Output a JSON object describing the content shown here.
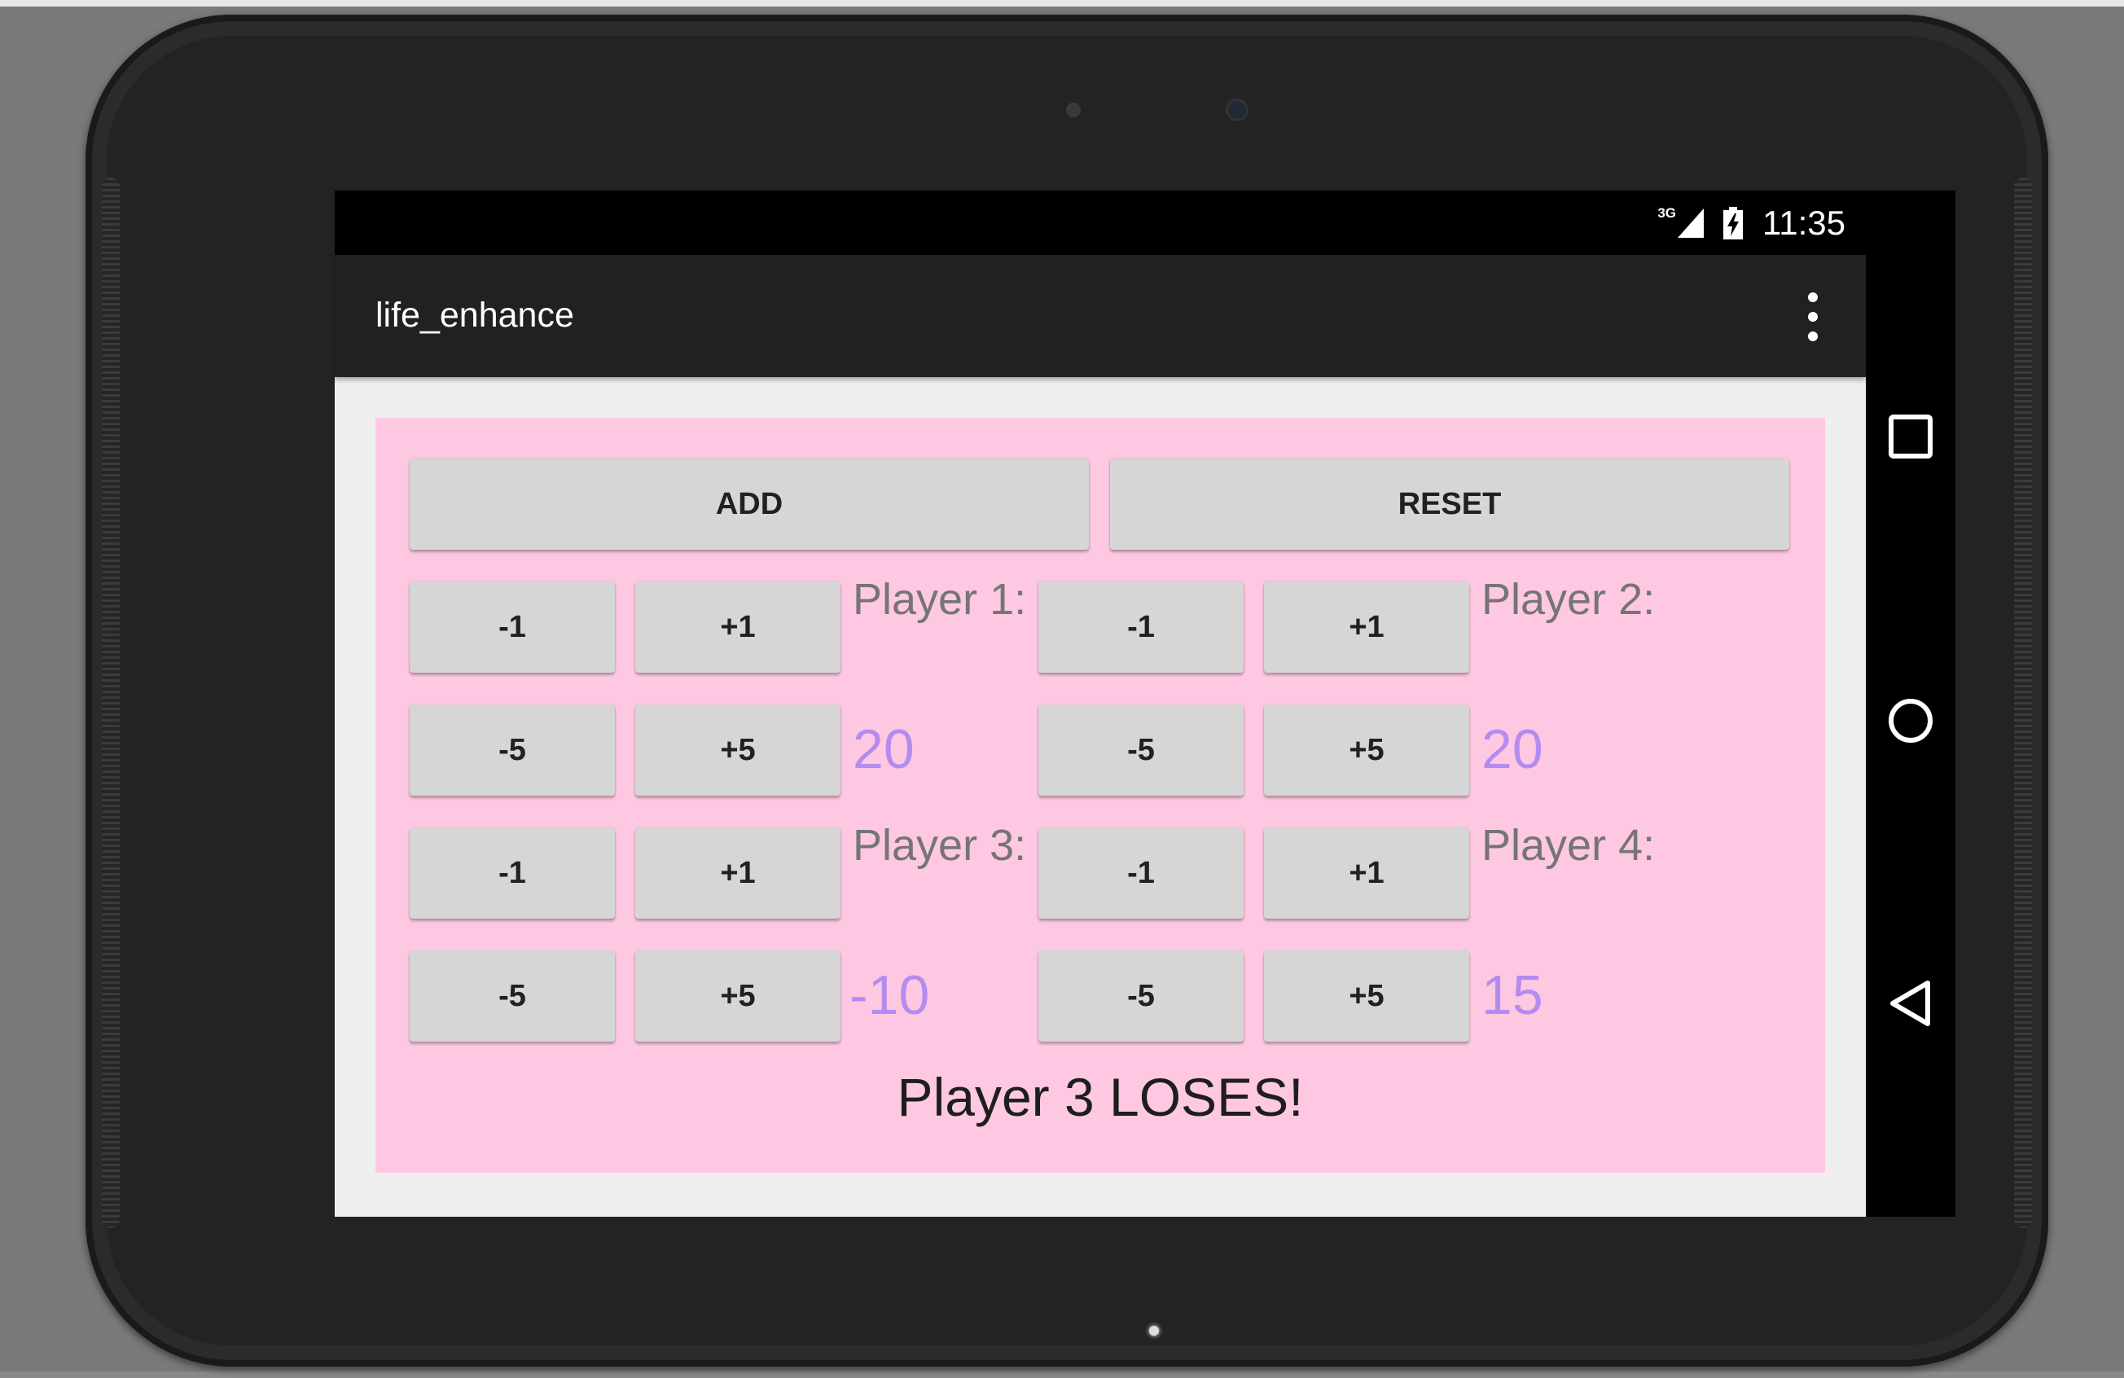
{
  "status_bar": {
    "network": "3G",
    "time": "11:35"
  },
  "action_bar": {
    "title": "life_enhance"
  },
  "toolbar": {
    "add_label": "ADD",
    "reset_label": "RESET"
  },
  "players": [
    {
      "label": "Player 1:",
      "life": "20",
      "buttons": [
        "-1",
        "+1",
        "-5",
        "+5"
      ]
    },
    {
      "label": "Player 2:",
      "life": "20",
      "buttons": [
        "-1",
        "+1",
        "-5",
        "+5"
      ]
    },
    {
      "label": "Player 3:",
      "life": "-10",
      "buttons": [
        "-1",
        "+1",
        "-5",
        "+5"
      ]
    },
    {
      "label": "Player 4:",
      "life": "15",
      "buttons": [
        "-1",
        "+1",
        "-5",
        "+5"
      ]
    }
  ],
  "message": "Player 3 LOSES!",
  "colors": {
    "panel": "#ffc8e2",
    "button": "#d6d6d6",
    "life_value": "#b48cf0",
    "action_bar": "#212121"
  },
  "icons": [
    "signal-icon",
    "battery-charging-icon",
    "overflow-menu-icon",
    "recents-icon",
    "home-icon",
    "back-icon"
  ]
}
